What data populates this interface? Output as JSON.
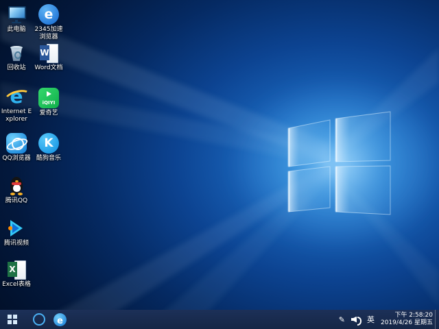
{
  "desktop": {
    "icons": [
      {
        "label": "此电脑"
      },
      {
        "label": "2345加速浏览器"
      },
      {
        "label": "回收站"
      },
      {
        "label": "Word文档"
      },
      {
        "label": "Internet Explorer"
      },
      {
        "label": "爱奇艺"
      },
      {
        "label": "QQ浏览器"
      },
      {
        "label": "酷狗音乐"
      },
      {
        "label": "腾讯QQ"
      },
      {
        "label": "腾讯视频"
      },
      {
        "label": "Excel表格"
      }
    ]
  },
  "glyphs": {
    "ie_e": "e",
    "b2345_e": "e",
    "word_w": "W",
    "excel_x": "X",
    "kugou_k": "K",
    "iqiyi_text": "iQIYI",
    "edge_e": "e",
    "pen": "✎"
  },
  "taskbar": {
    "tray": {
      "language": "英",
      "time": "下午 2:58:20",
      "date": "2019/4/26 星期五"
    }
  },
  "colors": {
    "taskbar": "#152646",
    "accent_blue": "#1277d4",
    "word_blue": "#2b579a",
    "excel_green": "#1e7145",
    "iqiyi_green": "#17c24f",
    "qq_red": "#e23b3b",
    "ie_blue": "#2fb3ef",
    "ie_ring_yellow": "#ffc83d",
    "wallpaper_dark": "#010d22"
  }
}
